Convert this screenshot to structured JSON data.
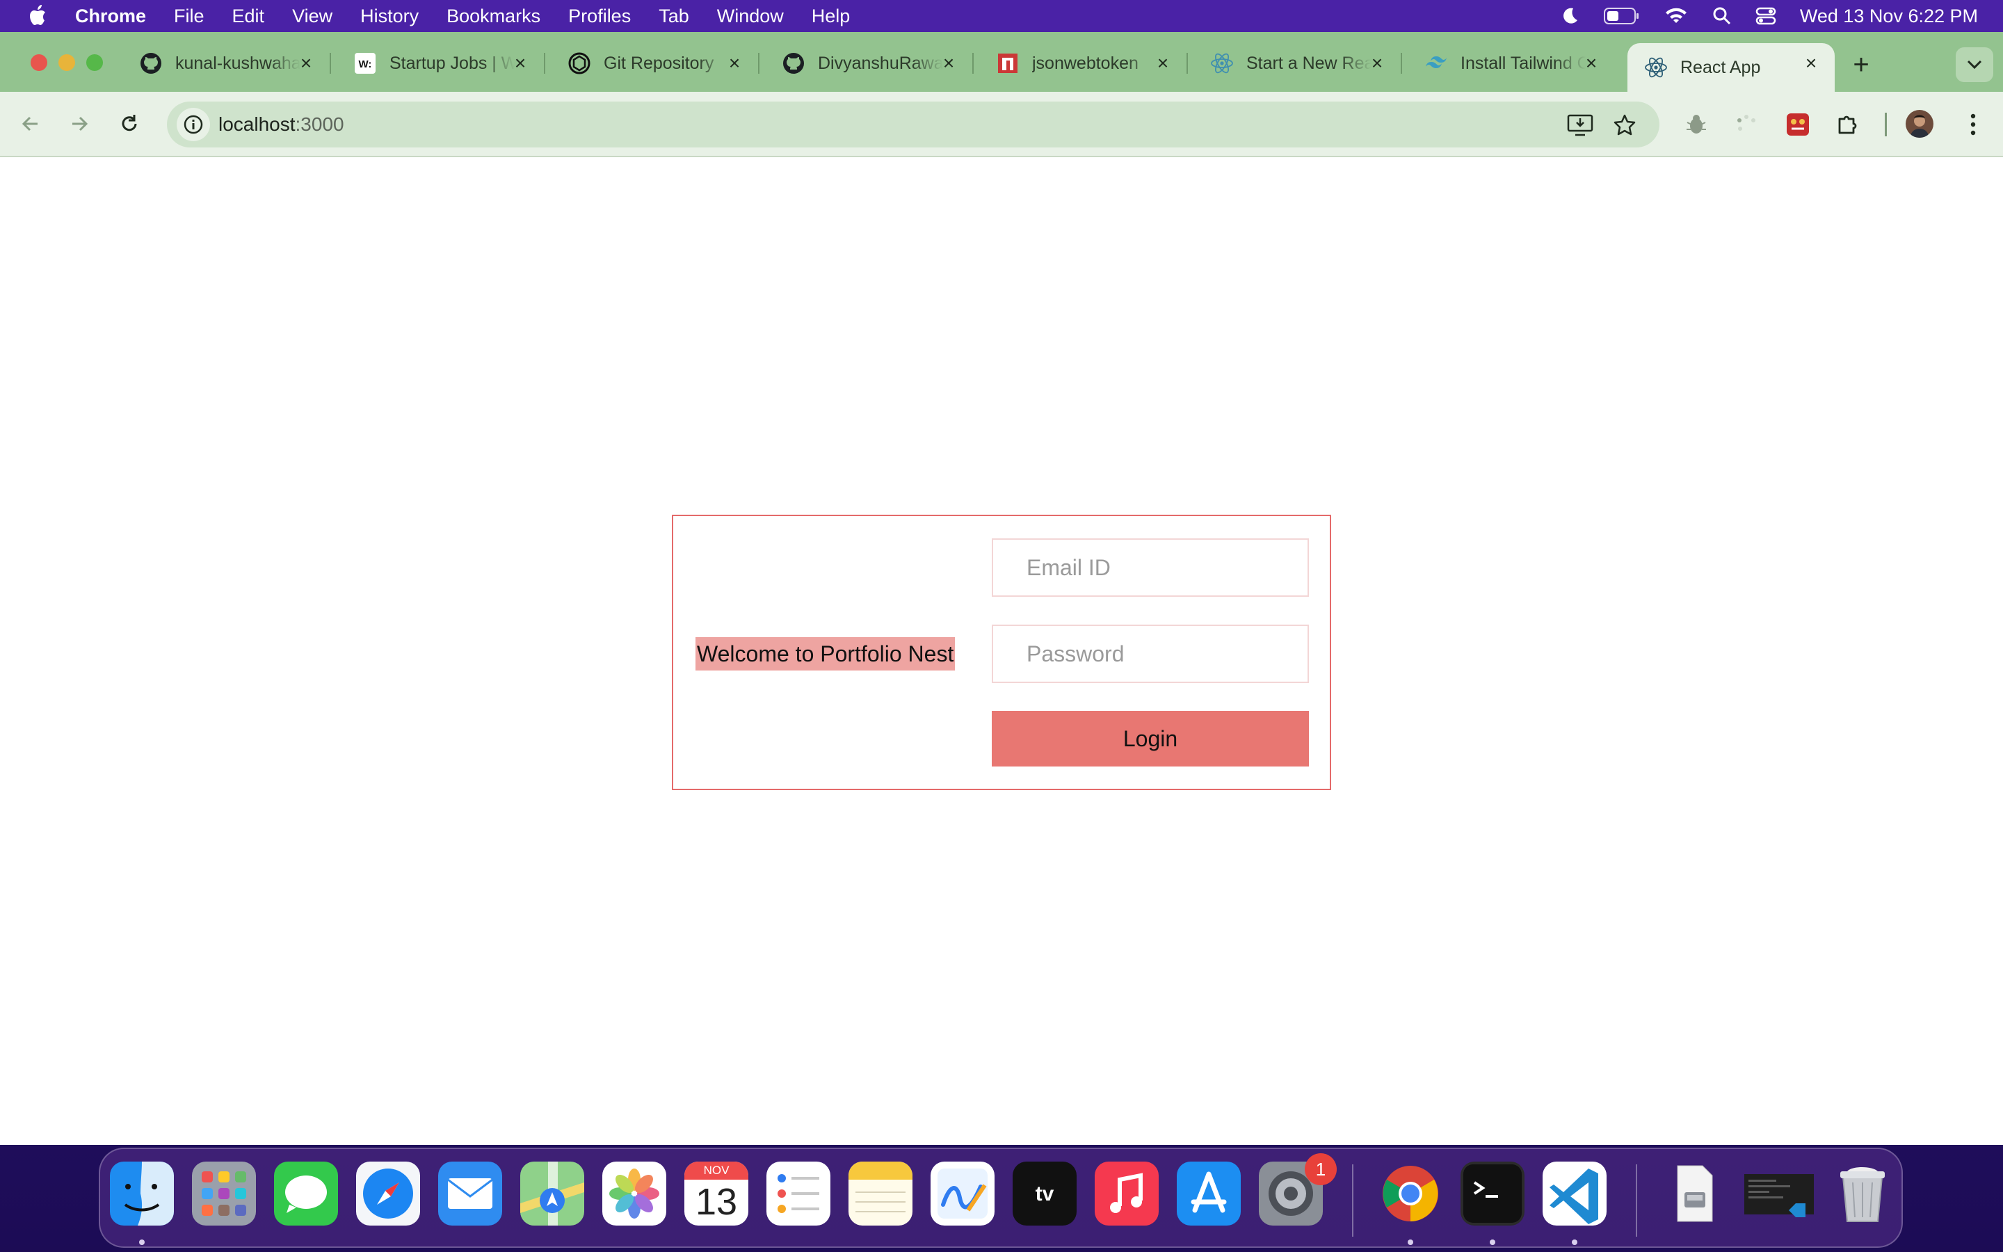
{
  "menubar": {
    "app_name": "Chrome",
    "menus": [
      "File",
      "Edit",
      "View",
      "History",
      "Bookmarks",
      "Profiles",
      "Tab",
      "Window",
      "Help"
    ],
    "clock": "Wed 13 Nov  6:22 PM"
  },
  "browser": {
    "tabs": [
      {
        "title": "kunal-kushwaha",
        "icon": "github-icon"
      },
      {
        "title": "Startup Jobs | Wellfound",
        "icon": "wellfound-icon"
      },
      {
        "title": "Git Repository",
        "icon": "openai-icon"
      },
      {
        "title": "DivyanshuRawat",
        "icon": "github-icon"
      },
      {
        "title": "jsonwebtoken",
        "icon": "npm-icon"
      },
      {
        "title": "Start a New React Project",
        "icon": "react-icon"
      },
      {
        "title": "Install Tailwind CSS",
        "icon": "tailwind-icon"
      },
      {
        "title": "React App",
        "icon": "react-icon",
        "active": true
      }
    ],
    "url_host": "localhost",
    "url_port": ":3000"
  },
  "page": {
    "welcome_text": "Welcome to Portfolio Nest",
    "email_placeholder": "Email ID",
    "password_placeholder": "Password",
    "login_label": "Login"
  },
  "dock": {
    "apps": [
      "Finder",
      "Launchpad",
      "Messages",
      "Safari",
      "Mail",
      "Maps",
      "Photos",
      "Calendar",
      "Reminders",
      "Notes",
      "Freeform",
      "TV",
      "Music",
      "App Store",
      "System Settings",
      "Chrome",
      "Terminal",
      "Visual Studio Code"
    ],
    "calendar_month": "NOV",
    "calendar_day": "13",
    "settings_badge": "1"
  },
  "colors": {
    "accent_border": "#e46a6a",
    "login_button": "#e87772",
    "welcome_highlight": "#eea4a1",
    "tabstrip": "#93c38f",
    "toolbar": "#e8f1e6"
  }
}
